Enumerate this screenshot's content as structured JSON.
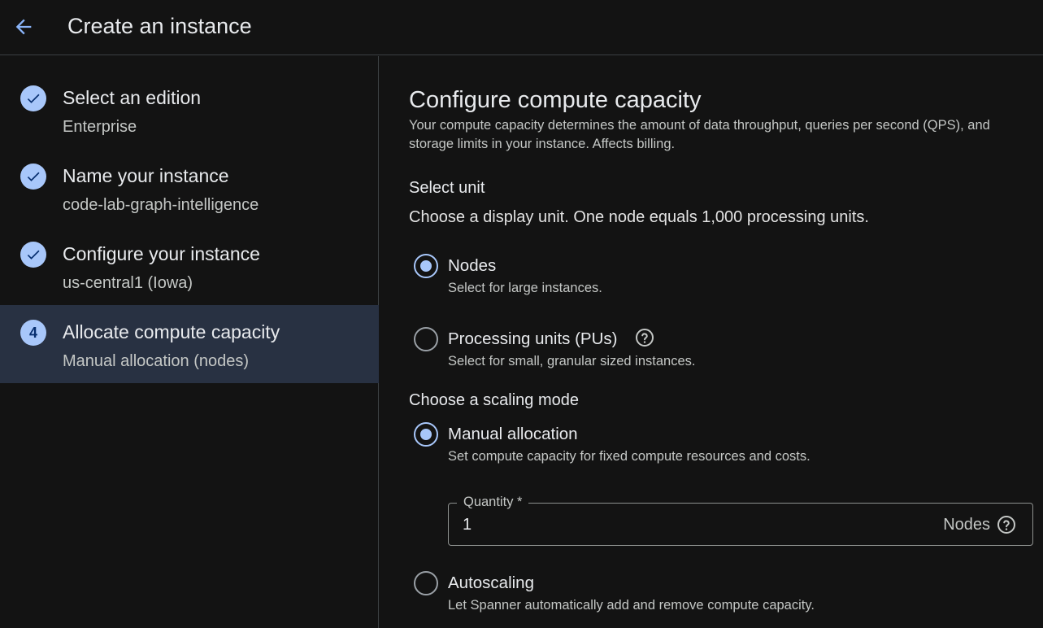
{
  "header": {
    "title": "Create an instance",
    "back_icon": "arrow-back-icon"
  },
  "colors": {
    "background": "#131313",
    "accent": "#a8c7fa",
    "active_step_bg": "#283142",
    "divider": "#3c4043"
  },
  "steps": [
    {
      "title": "Select an edition",
      "subtitle": "Enterprise",
      "status": "done",
      "icon": "check-icon"
    },
    {
      "title": "Name your instance",
      "subtitle": "code-lab-graph-intelligence",
      "status": "done",
      "icon": "check-icon"
    },
    {
      "title": "Configure your instance",
      "subtitle": "us-central1 (Iowa)",
      "status": "done",
      "icon": "check-icon"
    },
    {
      "title": "Allocate compute capacity",
      "subtitle": "Manual allocation (nodes)",
      "status": "active",
      "number": "4"
    }
  ],
  "main": {
    "title": "Configure compute capacity",
    "description": "Your compute capacity determines the amount of data throughput, queries per second (QPS), and storage limits in your instance. Affects billing.",
    "unit_section": {
      "heading": "Select unit",
      "description": "Choose a display unit. One node equals 1,000 processing units.",
      "options": [
        {
          "label": "Nodes",
          "description": "Select for large instances.",
          "selected": true
        },
        {
          "label": "Processing units (PUs)",
          "description": "Select for small, granular sized instances.",
          "selected": false
        }
      ]
    },
    "scaling_section": {
      "heading": "Choose a scaling mode",
      "options": [
        {
          "label": "Manual allocation",
          "description": "Set compute capacity for fixed compute resources and costs.",
          "selected": true
        },
        {
          "label": "Autoscaling",
          "description": "Let Spanner automatically add and remove compute capacity.",
          "selected": false
        }
      ],
      "quantity": {
        "label": "Quantity *",
        "value": "1",
        "suffix": "Nodes"
      }
    }
  }
}
